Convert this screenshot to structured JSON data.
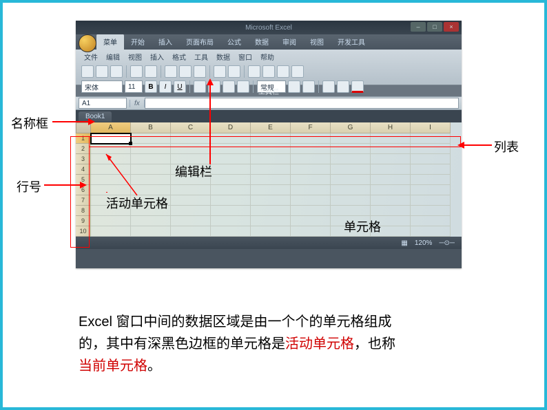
{
  "labels": {
    "namebox": "名称框",
    "rownum": "行号",
    "collist": "列表"
  },
  "overlay": {
    "editbar": "编辑栏",
    "activecell": "活动单元格",
    "cell": "单元格"
  },
  "excel": {
    "app_title": "Microsoft Excel",
    "book": "Book1",
    "namebox_value": "A1",
    "fx_label": "fx",
    "ribbon_tabs": [
      "菜单",
      "开始",
      "插入",
      "页面布局",
      "公式",
      "数据",
      "审阅",
      "视图",
      "开发工具"
    ],
    "classic_menu": [
      "文件",
      "编辑",
      "视图",
      "插入",
      "格式",
      "工具",
      "数据",
      "窗口",
      "帮助"
    ],
    "font_name": "宋体",
    "font_size": "11",
    "number_format": "常规",
    "toolbar_label": "工具栏",
    "columns": [
      "A",
      "B",
      "C",
      "D",
      "E",
      "F",
      "G",
      "H",
      "I"
    ],
    "rows": [
      "1",
      "2",
      "3",
      "4",
      "5",
      "6",
      "7",
      "8",
      "9",
      "10"
    ],
    "zoom": "120%",
    "win_min": "–",
    "win_max": "□",
    "win_close": "×"
  },
  "description": {
    "part1": "Excel 窗口中间的数据区域是由一个个的单元格组成的，其中有深黑色边框的单元格是",
    "red1": "活动单元格",
    "part2": "，也称",
    "red2": "当前单元格",
    "part3": "。"
  }
}
